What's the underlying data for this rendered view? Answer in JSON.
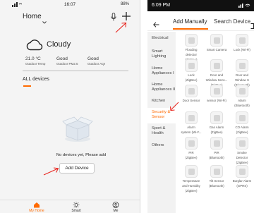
{
  "left": {
    "status_bar": {
      "time": "16:07",
      "battery": "88%"
    },
    "header": {
      "title": "Home"
    },
    "weather": {
      "condition": "Cloudy",
      "stats": [
        {
          "value": "21.0 °C",
          "label": "Outdoor Temp"
        },
        {
          "value": "Good",
          "label": "Outdoor PM2.5"
        },
        {
          "value": "Good",
          "label": "Outdoor AQI"
        }
      ]
    },
    "section_label": "ALL devices",
    "empty_text": "No devices yet, Please add",
    "add_button": "Add Device",
    "nav": [
      {
        "label": "My Home",
        "active": true
      },
      {
        "label": "Smart",
        "active": false
      },
      {
        "label": "Me",
        "active": false
      }
    ]
  },
  "right": {
    "status_bar": {
      "time": "6:09 PM"
    },
    "tabs": [
      {
        "label": "Add Manually",
        "active": true
      },
      {
        "label": "Search Device",
        "active": false
      }
    ],
    "categories": [
      "Electrical",
      "Smart Lighting",
      "Home Appliances I",
      "Home Appliances II",
      "Kitchen",
      "Security & Sensor",
      "Sport & Health",
      "Others"
    ],
    "active_category": "Security & Sensor",
    "devices": [
      {
        "name": [
          "Flooding",
          "detector",
          "(ZigBee)"
        ]
      },
      {
        "name": [
          "Smart Camera"
        ]
      },
      {
        "name": [
          "Lock (Wi-Fi)"
        ]
      },
      {
        "name": [
          "Lock",
          "(ZigBee)"
        ]
      },
      {
        "name": [
          "Door and",
          "Window Sens...",
          "(ZigBee)"
        ]
      },
      {
        "name": [
          "Door and",
          "Window S",
          "(Bluetooth)"
        ]
      },
      {
        "name": [
          "Door Sensor"
        ]
      },
      {
        "name": [
          "sensor (Wi-Fi)"
        ]
      },
      {
        "name": [
          "Alarm",
          "(Bluetooth)"
        ]
      },
      {
        "name": [
          "Alarm",
          "system (Wi-F..."
        ]
      },
      {
        "name": [
          "Gas Alarm",
          "(ZigBee)"
        ]
      },
      {
        "name": [
          "CO Alarm",
          "(ZigBee)"
        ]
      },
      {
        "name": [
          "PIR",
          "(ZigBee)"
        ]
      },
      {
        "name": [
          "PIR",
          "(Bluetooth)"
        ]
      },
      {
        "name": [
          "Smoke",
          "Detector",
          "(ZigBee)"
        ]
      },
      {
        "name": [
          "Temperature",
          "and Humidity",
          "(ZigBee)"
        ]
      },
      {
        "name": [
          "Tilt Sensor",
          "(Bluetooth)"
        ]
      },
      {
        "name": [
          "Burglar Alarm",
          "(GPRS)"
        ]
      }
    ]
  },
  "colors": {
    "accent": "#ff6a00",
    "annotation": "#e8261f"
  }
}
